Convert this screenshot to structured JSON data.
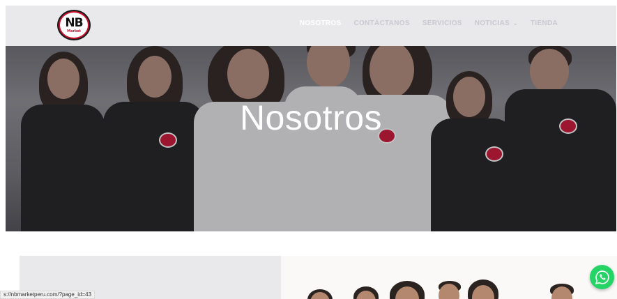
{
  "header": {
    "logo": {
      "text": "NB",
      "sub": "Market"
    },
    "nav": [
      {
        "label": "NOSOTROS",
        "active": true
      },
      {
        "label": "CONTÁCTANOS",
        "active": false
      },
      {
        "label": "SERVICIOS",
        "active": false
      },
      {
        "label": "NOTICIAS",
        "active": false,
        "dropdown": true
      },
      {
        "label": "TIENDA",
        "active": false
      }
    ]
  },
  "hero": {
    "title": "Nosotros"
  },
  "status_bar": {
    "url": "s://nbmarketperu.com/?page_id=43"
  },
  "icons": {
    "dropdown": "chevron-down-icon",
    "whatsapp": "whatsapp-icon"
  },
  "colors": {
    "brand_red": "#c8102e",
    "whatsapp_green": "#25d366",
    "nav_active": "#ffffff",
    "nav_inactive": "#c9c9cf"
  }
}
